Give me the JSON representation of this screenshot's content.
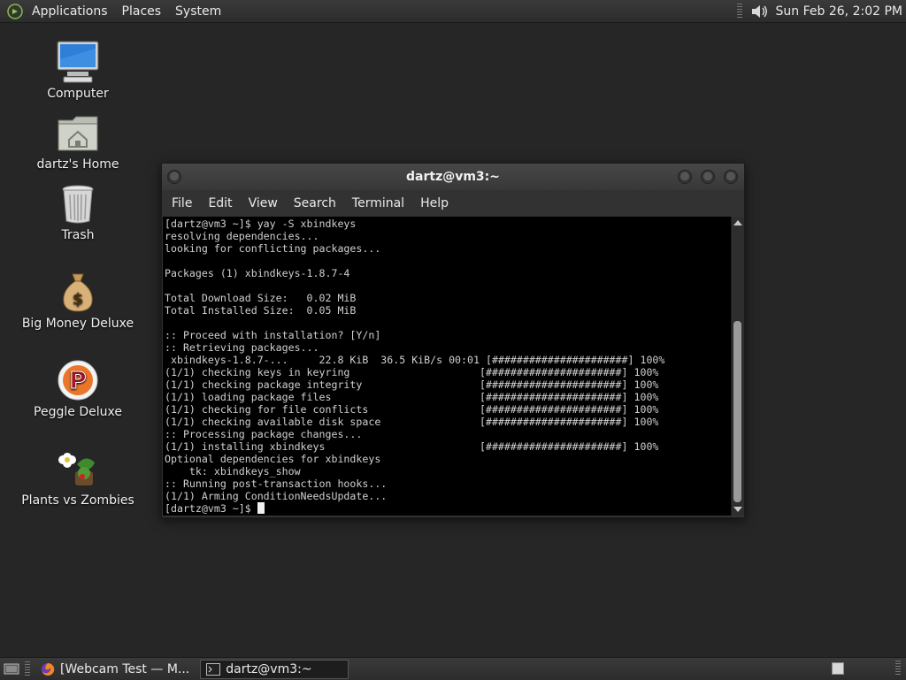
{
  "top_panel": {
    "menus": [
      "Applications",
      "Places",
      "System"
    ],
    "clock": "Sun Feb 26,  2:02 PM",
    "icons": {
      "logo": "mate-logo-icon",
      "volume": "speaker-icon"
    }
  },
  "desktop": {
    "icons": [
      {
        "label": "Computer",
        "icon": "computer-icon"
      },
      {
        "label": "dartz's Home",
        "icon": "home-folder-icon"
      },
      {
        "label": "Trash",
        "icon": "trash-icon"
      },
      {
        "label": "Big Money Deluxe",
        "icon": "money-bag-icon"
      },
      {
        "label": "Peggle Deluxe",
        "icon": "peggle-icon"
      },
      {
        "label": "Plants vs Zombies",
        "icon": "plants-vs-zombies-icon"
      }
    ]
  },
  "window": {
    "title": "dartz@vm3:~",
    "menu": [
      "File",
      "Edit",
      "View",
      "Search",
      "Terminal",
      "Help"
    ],
    "terminal_lines": [
      "[dartz@vm3 ~]$ yay -S xbindkeys",
      "resolving dependencies...",
      "looking for conflicting packages...",
      "",
      "Packages (1) xbindkeys-1.8.7-4",
      "",
      "Total Download Size:   0.02 MiB",
      "Total Installed Size:  0.05 MiB",
      "",
      ":: Proceed with installation? [Y/n]",
      ":: Retrieving packages...",
      " xbindkeys-1.8.7-...     22.8 KiB  36.5 KiB/s 00:01 [######################] 100%",
      "(1/1) checking keys in keyring                     [######################] 100%",
      "(1/1) checking package integrity                   [######################] 100%",
      "(1/1) loading package files                        [######################] 100%",
      "(1/1) checking for file conflicts                  [######################] 100%",
      "(1/1) checking available disk space                [######################] 100%",
      ":: Processing package changes...",
      "(1/1) installing xbindkeys                         [######################] 100%",
      "Optional dependencies for xbindkeys",
      "    tk: xbindkeys_show",
      ":: Running post-transaction hooks...",
      "(1/1) Arming ConditionNeedsUpdate..."
    ],
    "prompt": "[dartz@vm3 ~]$ "
  },
  "bottom_panel": {
    "tasks": [
      {
        "label": "[Webcam Test — M...",
        "icon": "firefox-icon",
        "active": false
      },
      {
        "label": "dartz@vm3:~",
        "icon": "terminal-icon",
        "active": true
      }
    ]
  }
}
